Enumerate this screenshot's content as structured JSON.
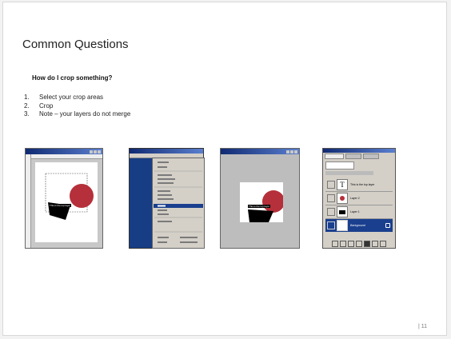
{
  "slide": {
    "title": "Common Questions",
    "question": "How do I crop something?",
    "steps": [
      {
        "num": "1.",
        "text": "Select your crop areas"
      },
      {
        "num": "2.",
        "text": "Crop"
      },
      {
        "num": "3.",
        "text": "Note – your layers do not merge"
      }
    ],
    "page_number": "| 11"
  },
  "screenshots": {
    "layer_caption": "This is the top layer",
    "layers": [
      {
        "name": "This is the top layer",
        "thumb": "T"
      },
      {
        "name": "Layer 2",
        "thumb": ""
      },
      {
        "name": "Layer 1",
        "thumb": ""
      },
      {
        "name": "Background",
        "thumb": ""
      }
    ]
  },
  "colors": {
    "accent_red": "#b5303a",
    "menu_blue": "#173e85",
    "selection_blue": "#1a3f8e"
  }
}
